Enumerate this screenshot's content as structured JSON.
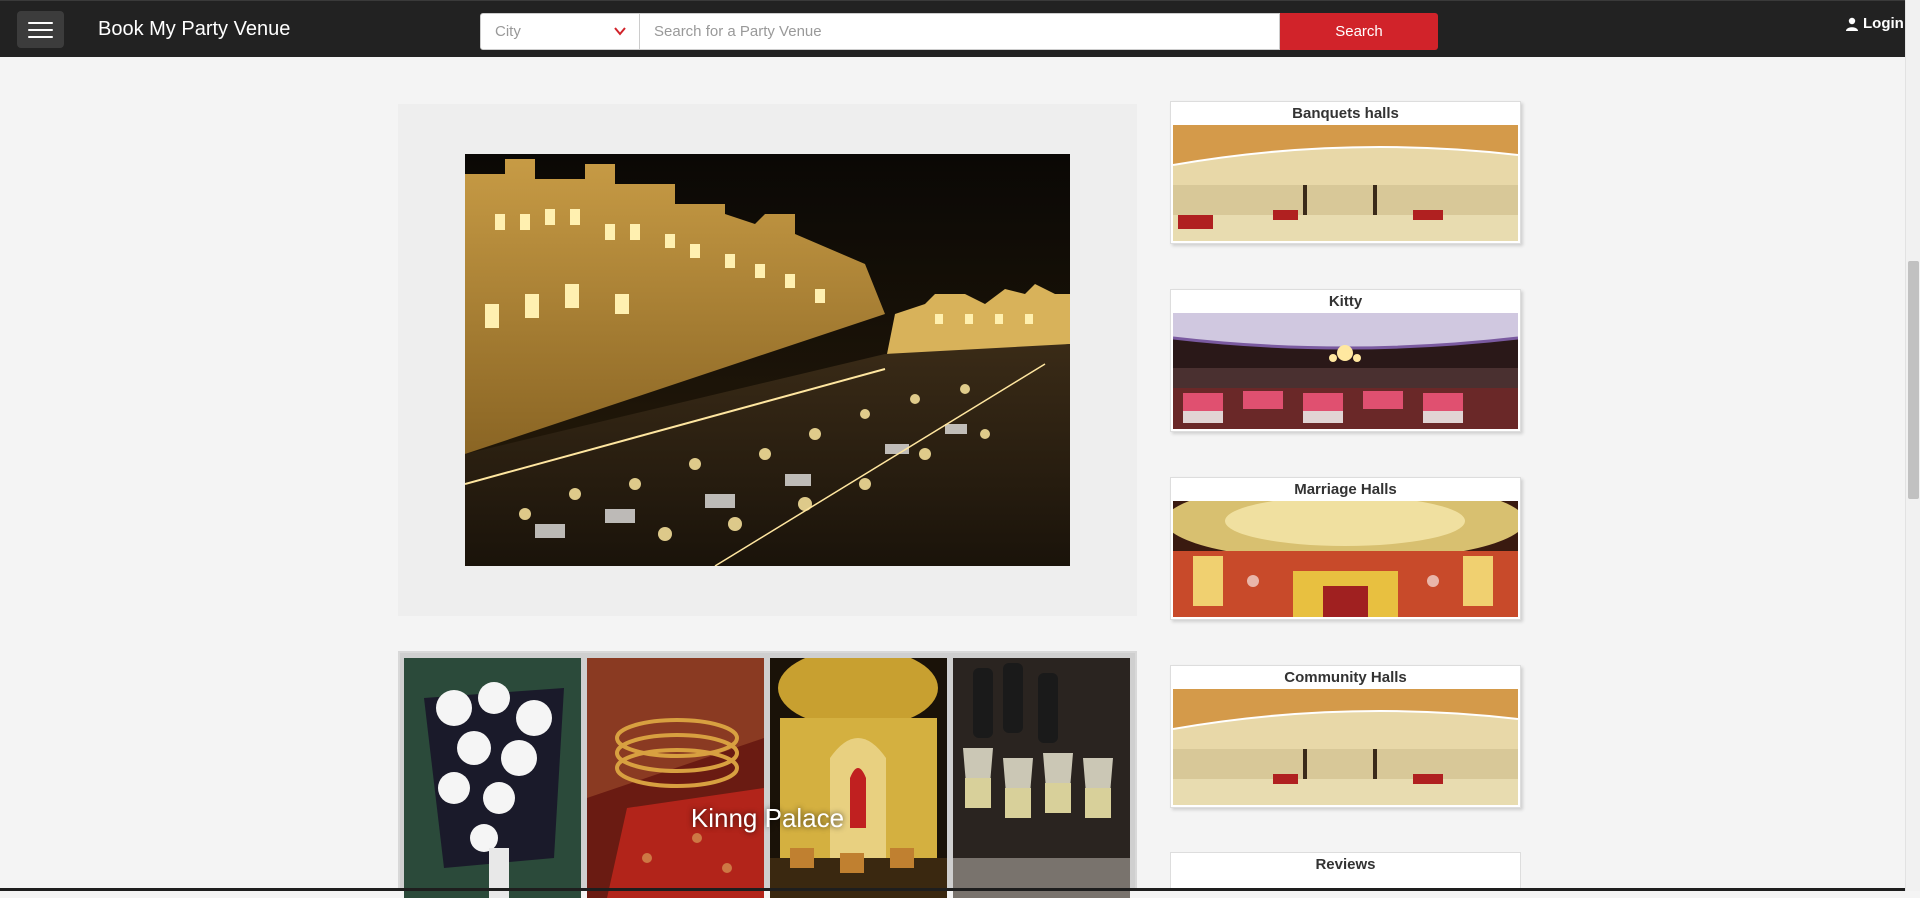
{
  "navbar": {
    "brand": "Book My Party Venue",
    "city_placeholder": "City",
    "search_placeholder": "Search for a Party Venue",
    "search_label": "Search",
    "login_label": "Login"
  },
  "hero": {
    "image": "palace-night-venue"
  },
  "gallery": {
    "caption": "Kinng Palace",
    "tiles": [
      "white-flower-bouquet",
      "bridal-henna-bangles",
      "decorated-mandap",
      "wine-glasses"
    ]
  },
  "categories": [
    {
      "label": "Banquets halls",
      "image": "banquet-hall-photo"
    },
    {
      "label": "Kitty",
      "image": "kitty-party-hall-photo"
    },
    {
      "label": "Marriage Halls",
      "image": "marriage-hall-photo"
    },
    {
      "label": "Community Halls",
      "image": "community-hall-photo"
    }
  ],
  "reviews": {
    "title": "Reviews"
  },
  "colors": {
    "navbar_bg": "#222222",
    "accent_red": "#d1232a",
    "page_bg": "#f4f4f4"
  }
}
